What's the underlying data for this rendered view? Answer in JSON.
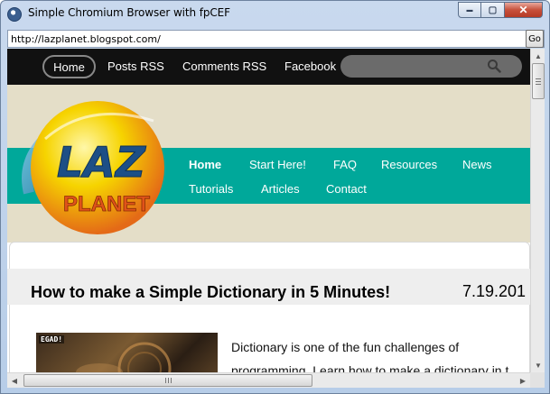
{
  "window": {
    "title": "Simple Chromium Browser with fpCEF",
    "minimize_label": "▬",
    "maximize_label": "▢",
    "close_label": "✕"
  },
  "address_bar": {
    "url": "http://lazplanet.blogspot.com/",
    "go_label": "Go"
  },
  "top_nav": {
    "home": "Home",
    "posts_rss": "Posts RSS",
    "comments_rss": "Comments RSS",
    "facebook": "Facebook",
    "search_value": ""
  },
  "logo": {
    "line1": "LAZ",
    "line2": "PLANET"
  },
  "main_nav": {
    "items": [
      "Home",
      "Start Here!",
      "FAQ",
      "Resources",
      "News",
      "Tutorials",
      "Articles",
      "Contact"
    ],
    "active_index": 0
  },
  "post": {
    "title": "How to make a Simple Dictionary in 5 Minutes!",
    "date": "7.19.201",
    "thumbnail_caption": "EGAD!",
    "excerpt_line1": "Dictionary is one of the fun challenges of",
    "excerpt_line2": "programming. Learn how to make a dictionary in t"
  },
  "colors": {
    "top_nav_bg": "#111111",
    "teal_nav_bg": "#00a89a",
    "header_bg": "#e4dec8",
    "logo_yellow": "#f6d400",
    "logo_orange": "#e46a17",
    "logo_blue": "#2f6ea8"
  },
  "icons": {
    "search": "search-icon",
    "app": "app-icon",
    "scroll_up": "scroll-up-arrow-icon",
    "scroll_down": "scroll-down-arrow-icon",
    "scroll_left": "scroll-left-arrow-icon",
    "scroll_right": "scroll-right-arrow-icon"
  }
}
